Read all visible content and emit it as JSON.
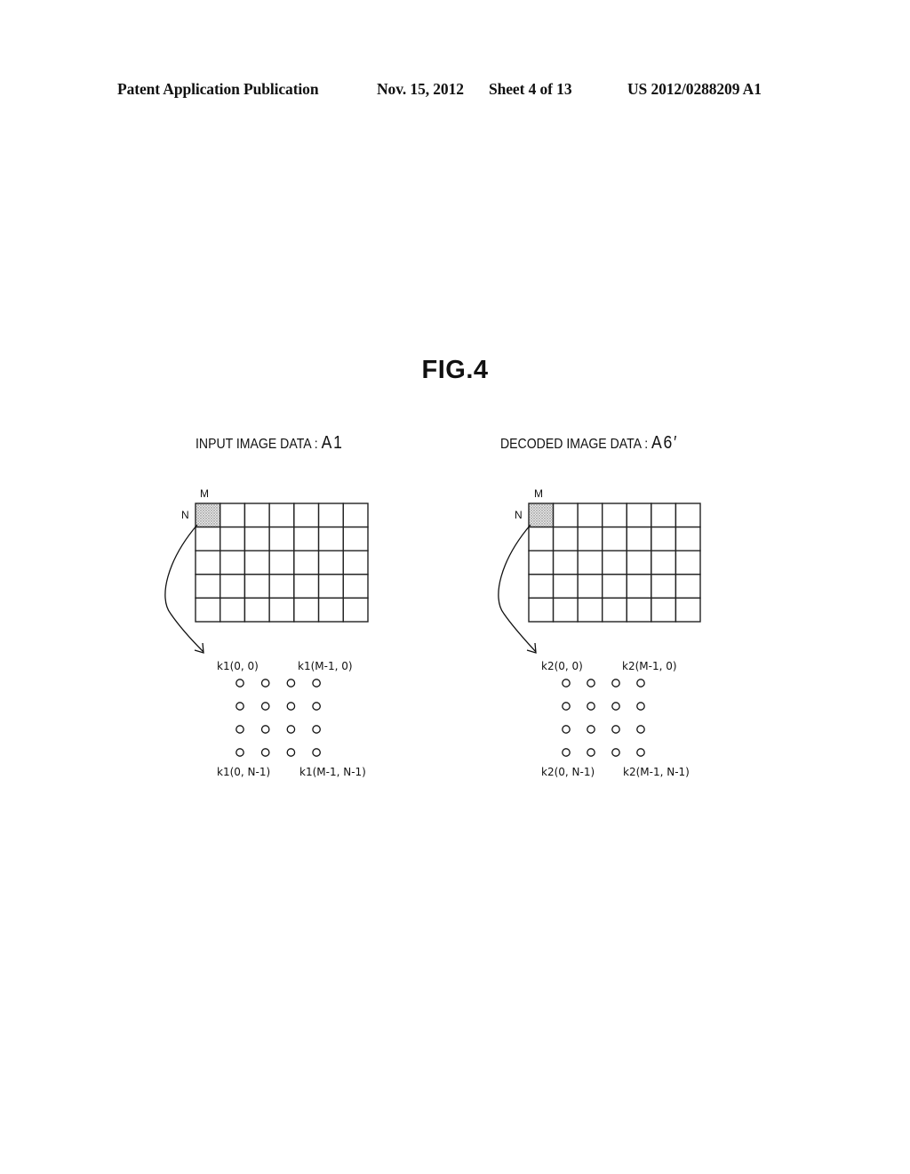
{
  "header": {
    "publication": "Patent Application Publication",
    "date": "Nov. 15, 2012",
    "sheet": "Sheet 4 of 13",
    "number": "US 2012/0288209 A1"
  },
  "figure": {
    "title": "FIG.4",
    "panels": [
      {
        "id": "left",
        "title_text": "INPUT IMAGE DATA : ",
        "title_ref": "A1",
        "col_label": "M",
        "row_label": "N",
        "grid_cols": 7,
        "grid_rows": 5,
        "highlighted_cell": [
          0,
          0
        ],
        "coef_labels": {
          "top_left": "k1(0, 0)",
          "top_right": "k1(M-1, 0)",
          "bottom_left": "k1(0, N-1)",
          "bottom_right": "k1(M-1, N-1)"
        },
        "dot_cols": 4,
        "dot_rows": 4
      },
      {
        "id": "right",
        "title_text": "DECODED IMAGE DATA : ",
        "title_ref": "A6′",
        "col_label": "M",
        "row_label": "N",
        "grid_cols": 7,
        "grid_rows": 5,
        "highlighted_cell": [
          0,
          0
        ],
        "coef_labels": {
          "top_left": "k2(0, 0)",
          "top_right": "k2(M-1, 0)",
          "bottom_left": "k2(0, N-1)",
          "bottom_right": "k2(M-1, N-1)"
        },
        "dot_cols": 4,
        "dot_rows": 4
      }
    ]
  }
}
